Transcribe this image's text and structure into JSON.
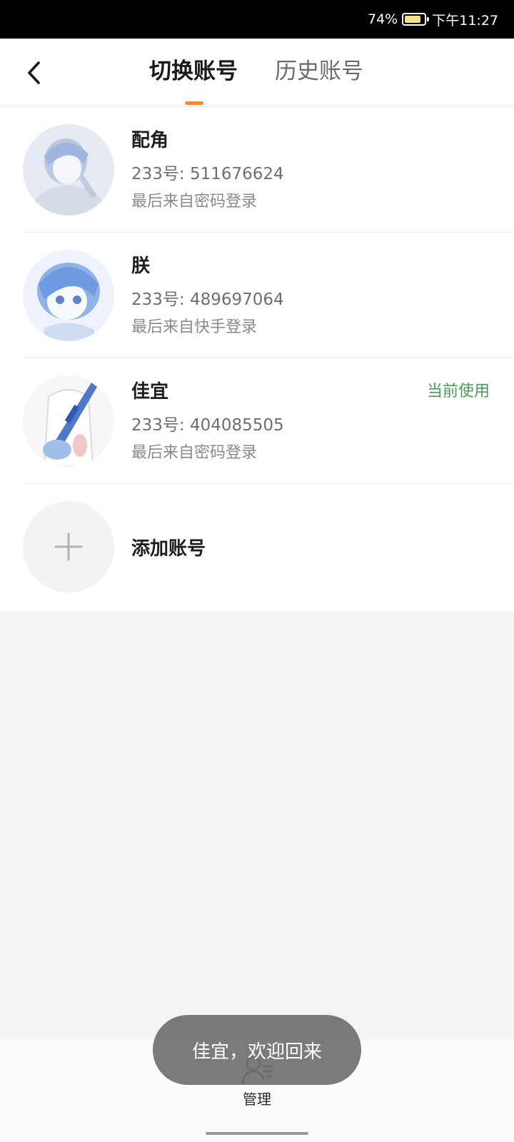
{
  "status_bar": {
    "battery": "74%",
    "time": "下午11:27"
  },
  "header": {
    "tabs": [
      {
        "label": "切换账号",
        "active": true
      },
      {
        "label": "历史账号",
        "active": false
      }
    ]
  },
  "accounts": [
    {
      "name": "配角",
      "id": "233号: 511676624",
      "login": "最后来自密码登录",
      "current": ""
    },
    {
      "name": "朕",
      "id": "233号: 489697064",
      "login": "最后来自快手登录",
      "current": ""
    },
    {
      "name": "佳宜",
      "id": "233号: 404085505",
      "login": "最后来自密码登录",
      "current": "当前使用"
    }
  ],
  "add_account": {
    "label": "添加账号"
  },
  "bottom": {
    "manage_label": "管理"
  },
  "toast": {
    "message": "佳宜，欢迎回来"
  },
  "colors": {
    "accent": "#f08a3c",
    "current_badge": "#4a9a5a",
    "page_background": "#f4f3f5",
    "toast_background": "#707070"
  }
}
